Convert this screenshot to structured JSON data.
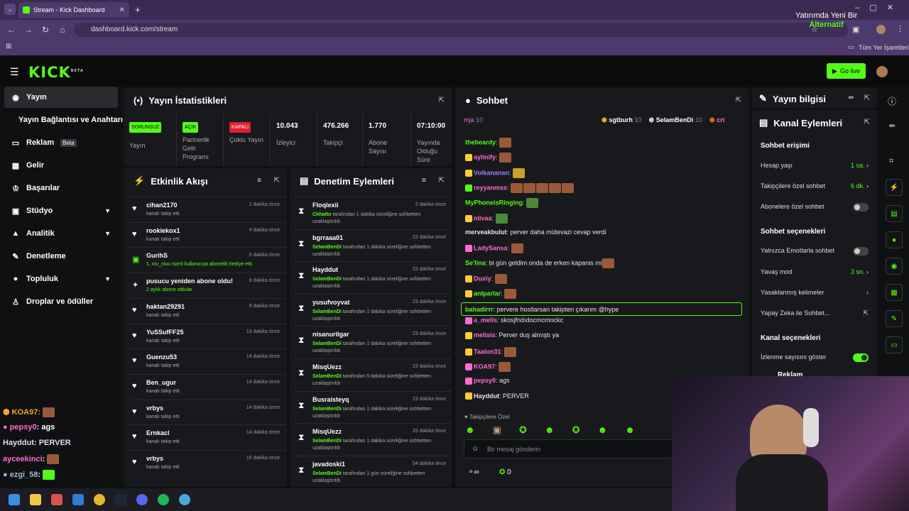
{
  "browser": {
    "tab_title": "Stream - Kick Dashboard",
    "url": "dashboard.kick.com/stream",
    "bookmarks_label": "Tüm Yer İşaretleri"
  },
  "ad": {
    "line1": "Yatırımda Yeni Bir",
    "line2": "Alternatif"
  },
  "kick": {
    "logo": "KICK",
    "logo_sup": "BETA",
    "go_live": "Go live"
  },
  "sidebar": {
    "items": [
      {
        "label": "Yayın",
        "icon": "stream-icon"
      },
      {
        "label": "Yayın Bağlantısı ve Anahtarı",
        "icon": "key-icon"
      },
      {
        "label": "Reklam",
        "badge": "Beta",
        "icon": "ad-icon"
      },
      {
        "label": "Gelir",
        "icon": "revenue-icon"
      },
      {
        "label": "Başarılar",
        "icon": "trophy-icon"
      },
      {
        "label": "Stüdyo",
        "icon": "studio-icon"
      },
      {
        "label": "Analitik",
        "icon": "analytics-icon"
      },
      {
        "label": "Denetleme",
        "icon": "wrench-icon"
      },
      {
        "label": "Topluluk",
        "icon": "community-icon"
      },
      {
        "label": "Droplar ve ödüller",
        "icon": "drops-icon"
      }
    ]
  },
  "stats": {
    "title": "Yayın İstatistikleri",
    "cols": [
      {
        "badge": "SORUNSUZ",
        "label": "Yayın"
      },
      {
        "badge": "AÇIK",
        "label": "Partnerlik Gelir Programı"
      },
      {
        "badge": "KAPALI",
        "label": "Çoklu Yayın"
      },
      {
        "value": "10.043",
        "label": "İzleyici"
      },
      {
        "value": "476.266",
        "label": "Takipçi"
      },
      {
        "value": "1.770",
        "label": "Abone Sayısı"
      },
      {
        "value": "07:10:00",
        "label": "Yayında Olduğu Süre"
      }
    ]
  },
  "activity": {
    "title": "Etkinlik Akışı",
    "rows": [
      {
        "name": "cihan2170",
        "desc": "kanalı takip etti",
        "time": "2 dakika önce"
      },
      {
        "name": "rookiekox1",
        "desc": "kanalı takip etti",
        "time": "4 dakika önce"
      },
      {
        "name": "GurihS",
        "desc": "1, niu_niuu isimli kullanıcıya abonelik hediye etti.",
        "time": "6 dakika önce"
      },
      {
        "name": "pusucu yeniden abone oldu!",
        "desc": "2 aylık abone oldular",
        "time": "8 dakika önce"
      },
      {
        "name": "haktan29291",
        "desc": "kanalı takip etti",
        "time": "9 dakika önce"
      },
      {
        "name": "YuSSufFF25",
        "desc": "kanalı takip etti",
        "time": "13 dakika önce"
      },
      {
        "name": "Guenzu53",
        "desc": "kanalı takip etti",
        "time": "14 dakika önce"
      },
      {
        "name": "Ben_ugur",
        "desc": "kanalı takip etti",
        "time": "14 dakika önce"
      },
      {
        "name": "vrbys",
        "desc": "kanalı takip etti",
        "time": "14 dakika önce"
      },
      {
        "name": "Ernkacl",
        "desc": "kanalı takip etti",
        "time": "14 dakika önce"
      },
      {
        "name": "vrbys",
        "desc": "kanalı takip etti",
        "time": "15 dakika önce"
      }
    ]
  },
  "moderation": {
    "title": "Denetim Eylemleri",
    "rows": [
      {
        "name": "Floqlexii",
        "mod": "Chhatto",
        "desc": " tarafından 1 dakika süreliğine sohbetten uzaklaştırıldı",
        "time": "2 dakika önce"
      },
      {
        "name": "bgrraaa01",
        "mod": "SelamBenDi",
        "desc": " tarafından 1 dakika süreliğine sohbetten uzaklaştırıldı",
        "time": "22 dakika önce"
      },
      {
        "name": "Hayddut",
        "mod": "SelamBenDi",
        "desc": " tarafından 1 dakika süreliğine sohbetten uzaklaştırıldı",
        "time": "22 dakika önce"
      },
      {
        "name": "yusufvoyvat",
        "mod": "SelamBenDi",
        "desc": " tarafından 1 dakika süreliğine sohbetten uzaklaştırıldı",
        "time": "23 dakika önce"
      },
      {
        "name": "nisanurilgar",
        "mod": "SelamBenDi",
        "desc": " tarafından 1 dakika süreliğine sohbetten uzaklaştırıldı",
        "time": "23 dakika önce"
      },
      {
        "name": "MisqUezz",
        "mod": "SelamBenDi",
        "desc": " tarafından 5 dakika süreliğine sohbetten uzaklaştırıldı",
        "time": "23 dakika önce"
      },
      {
        "name": "Busraisteyq",
        "mod": "SelamBenDi",
        "desc": " tarafından 1 dakika süreliğine sohbetten uzaklaştırıldı",
        "time": "23 dakika önce"
      },
      {
        "name": "MisqUezz",
        "mod": "SelamBenDi",
        "desc": " tarafından 1 dakika süreliğine sohbetten uzaklaştırıldı",
        "time": "25 dakika önce"
      },
      {
        "name": "javadoski1",
        "mod": "SelamBenDi",
        "desc": " tarafından 1 gün süreliğine sohbetten uzaklaştırıldı",
        "time": "54 dakika önce"
      }
    ]
  },
  "chat": {
    "title": "Sohbet",
    "pinned": [
      {
        "name": "mja",
        "count": "10"
      },
      {
        "name": "sgtburh",
        "count": "10"
      },
      {
        "name": "SelamBenDi",
        "count": "10"
      },
      {
        "name": "cri",
        "count": ""
      }
    ],
    "messages": [
      {
        "user": "thebeardy",
        "color": "#53fc18",
        "text": ""
      },
      {
        "user": "aylinify",
        "color": "#ff6ad5",
        "text": ""
      },
      {
        "user": "Volkananan",
        "color": "#9b7dff",
        "text": ""
      },
      {
        "user": "reyyanmss",
        "color": "#ff6ad5",
        "text": ""
      },
      {
        "user": "MyPhoneisRinging",
        "color": "#53fc18",
        "text": ""
      },
      {
        "user": "niivaa",
        "color": "#ff6ad5",
        "text": ""
      },
      {
        "user": "merveakbulut",
        "color": "#e6e6e6",
        "text": "perver daha mütevazi cevap verdi"
      },
      {
        "user": "LadySansa",
        "color": "#ff6ad5",
        "text": ""
      },
      {
        "user": "Se'lina",
        "color": "#53fc18",
        "text": "bi gün geldim onda de erken kapanis mi"
      },
      {
        "user": "Duxiy",
        "color": "#ff6ad5",
        "text": ""
      },
      {
        "user": "anlparlar",
        "color": "#53fc18",
        "text": ""
      },
      {
        "user": "bahadirrr",
        "color": "#53fc18",
        "text": "pervere hostlarsan takipten çıkarım @hype"
      },
      {
        "user": "a_melis",
        "color": "#ff6ad5",
        "text": "skosjfndıdocmcmnckc"
      },
      {
        "user": "melisis",
        "color": "#ff6ad5",
        "text": "Perver duş almıştı ya"
      },
      {
        "user": "Taalon31",
        "color": "#ff6ad5",
        "text": ""
      },
      {
        "user": "KOA97",
        "color": "#ff6ad5",
        "text": ""
      },
      {
        "user": "pepsy0",
        "color": "#ff6ad5",
        "text": "ags"
      },
      {
        "user": "Hayddut",
        "color": "#e6e6e6",
        "text": "PERVER"
      }
    ],
    "followers_only": "Takipçilere Özel",
    "input_placeholder": "Bir mesaj gönderin",
    "count": "0"
  },
  "info": {
    "title": "Yayın bilgisi"
  },
  "channel": {
    "title": "Kanal Eylemleri",
    "access": "Sohbet erişimi",
    "rows1": [
      {
        "label": "Hesap yaşı",
        "value": "1 sa."
      },
      {
        "label": "Takipçilere özel sohbet",
        "value": "6 dk."
      },
      {
        "label": "Abonelere özel sohbet",
        "value": ""
      }
    ],
    "chat_opts": "Sohbet seçenekleri",
    "rows2": [
      {
        "label": "Yalnızca Emotlarla sohbet",
        "value": ""
      },
      {
        "label": "Yavaş mod",
        "value": "3 sn."
      },
      {
        "label": "Yasaklanmış kelimeler",
        "value": ""
      },
      {
        "label": "Yapay Zeka ile Sohbet...",
        "value": ""
      }
    ],
    "channel_opts": "Kanal seçenekleri",
    "show_count": "İzlenme sayısını göster",
    "ad": "Reklam"
  },
  "overlay": [
    {
      "user": "KOA97",
      "text": ":"
    },
    {
      "user": "pepsy0",
      "text": ": ags"
    },
    {
      "user": "Hayddut",
      "text": ": PERVER"
    },
    {
      "user": "ayceekinci",
      "text": ":"
    },
    {
      "user": "ezgi_58",
      "text": ":"
    }
  ]
}
